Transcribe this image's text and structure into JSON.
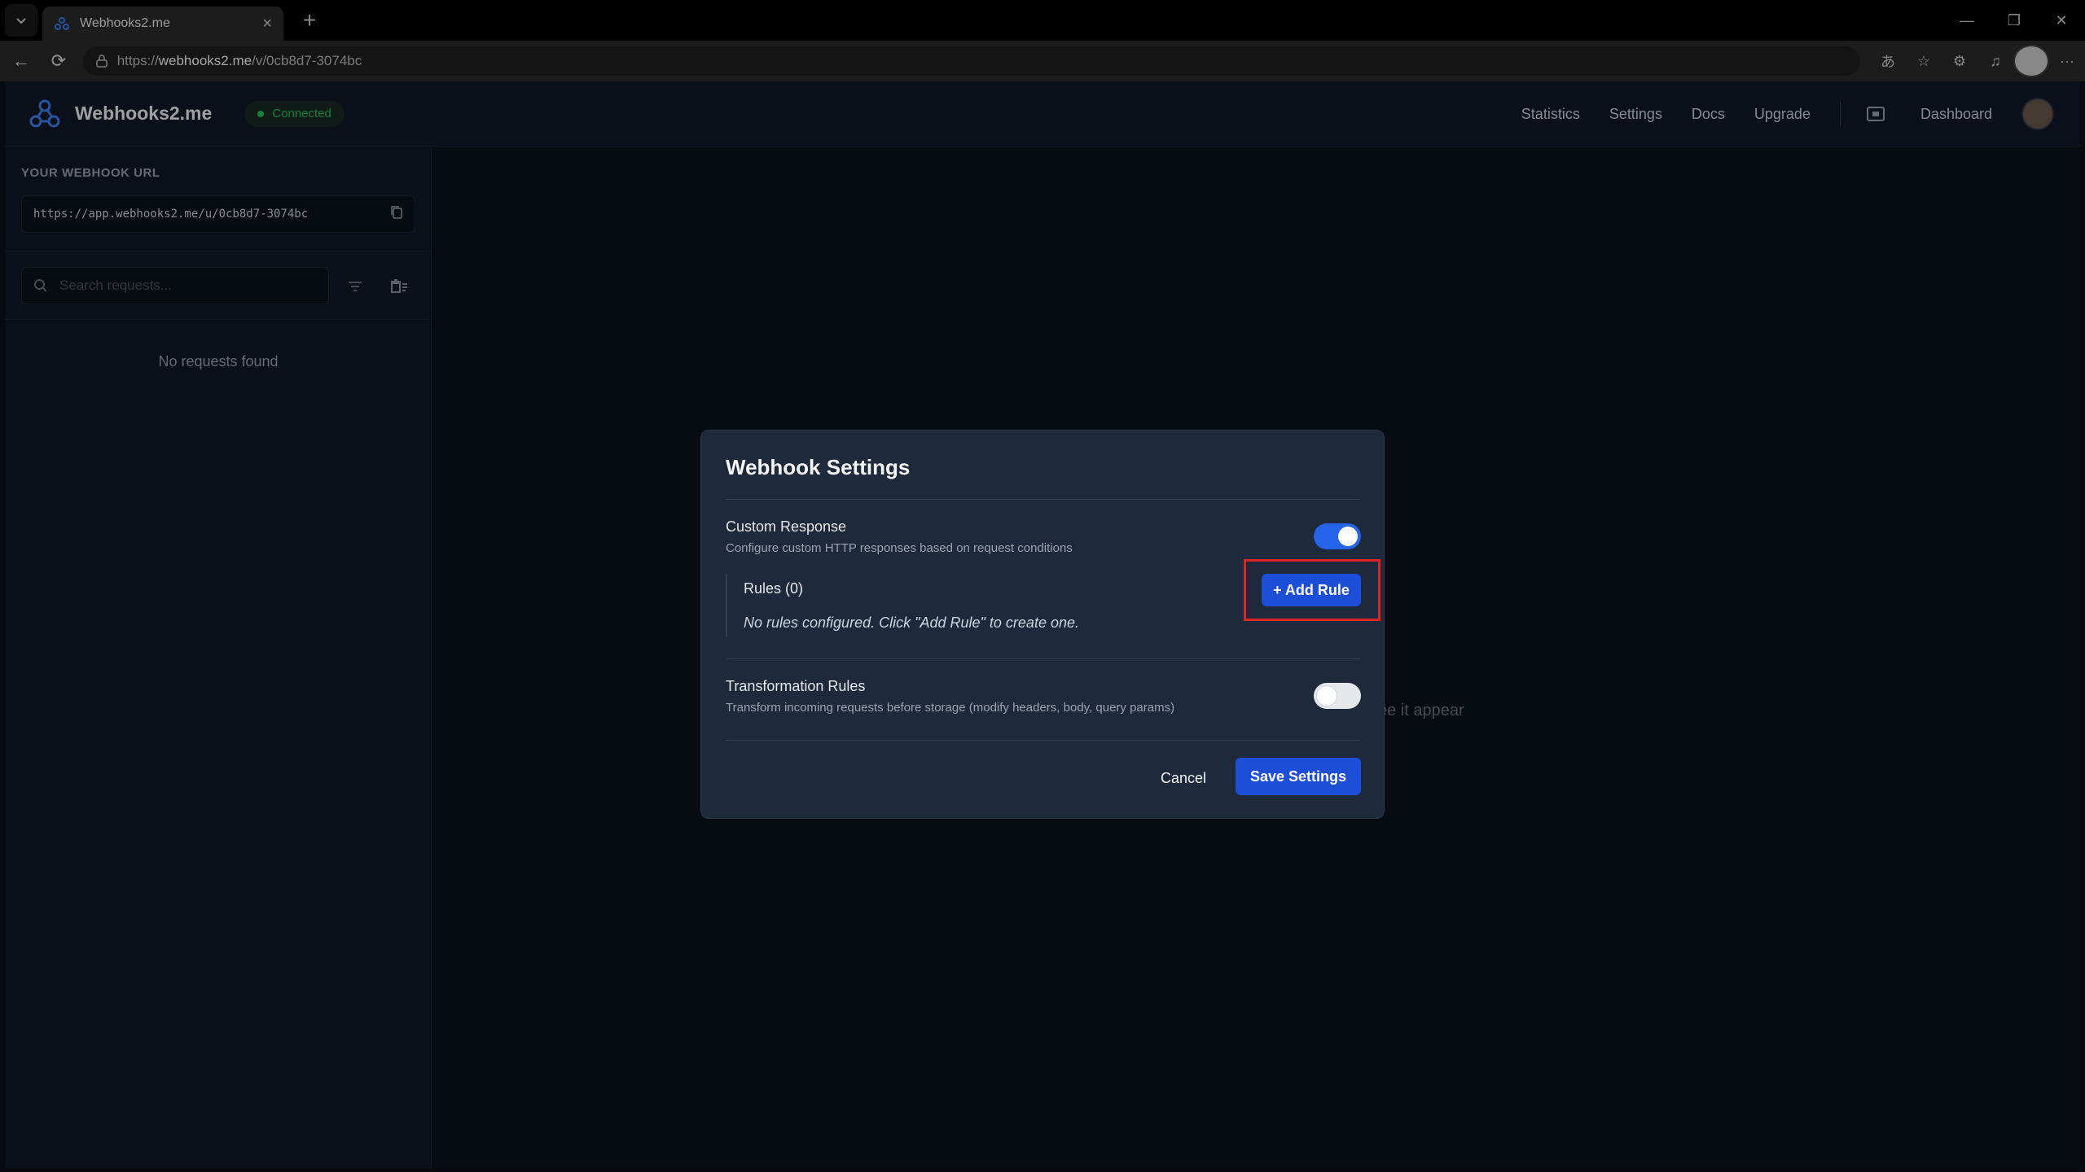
{
  "browser": {
    "tab_title": "Webhooks2.me",
    "url_scheme": "https://",
    "url_host": "webhooks2.me",
    "url_path": "/v/0cb8d7-3074bc"
  },
  "app": {
    "brand_name": "Webhooks2.me",
    "connection_status": "Connected",
    "nav": {
      "statistics": "Statistics",
      "settings": "Settings",
      "docs": "Docs",
      "upgrade": "Upgrade",
      "dashboard": "Dashboard"
    }
  },
  "sidebar": {
    "webhook_url_label": "YOUR WEBHOOK URL",
    "webhook_url": "https://app.webhooks2.me/u/0cb8d7-3074bc",
    "search_placeholder": "Search requests...",
    "empty_text": "No requests found"
  },
  "main": {
    "hint_fragment": "ee it appear"
  },
  "modal": {
    "title": "Webhook Settings",
    "custom_response": {
      "title": "Custom Response",
      "description": "Configure custom HTTP responses based on request conditions",
      "enabled": true
    },
    "rules": {
      "title": "Rules (0)",
      "empty_text": "No rules configured. Click \"Add Rule\" to create one.",
      "add_label": "+ Add Rule"
    },
    "transformation": {
      "title": "Transformation Rules",
      "description": "Transform incoming requests before storage (modify headers, body, query params)",
      "enabled": false
    },
    "cancel_label": "Cancel",
    "save_label": "Save Settings"
  },
  "colors": {
    "accent": "#1d4ed8",
    "status_green": "#22c55e",
    "highlight": "#dc2626"
  }
}
